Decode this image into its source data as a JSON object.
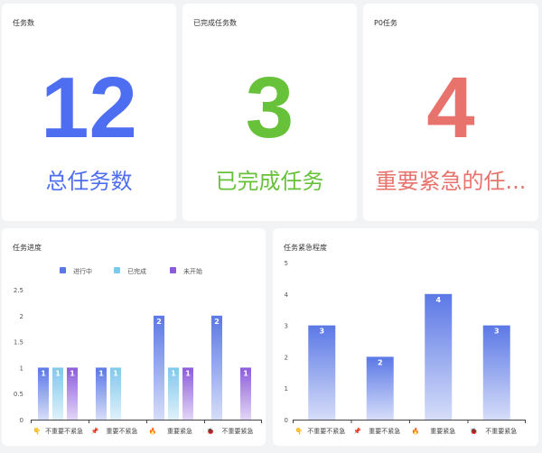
{
  "stats": [
    {
      "title": "任务数",
      "value": "12",
      "label": "总任务数",
      "color": "#4e6ef2"
    },
    {
      "title": "已完成任务数",
      "value": "3",
      "label": "已完成任务",
      "color": "#67c23a"
    },
    {
      "title": "P0任务",
      "value": "4",
      "label": "重要紧急的任...",
      "color": "#e8736c"
    }
  ],
  "progress_chart": {
    "title": "任务进度"
  },
  "urgency_chart": {
    "title": "任务紧急程度"
  },
  "chart_data": [
    {
      "type": "bar",
      "title": "任务进度",
      "categories": [
        "不重要不紧急",
        "重要不紧急",
        "重要紧急",
        "不重要紧急"
      ],
      "category_icons": [
        "👇",
        "📌",
        "🔥",
        "🐞"
      ],
      "series": [
        {
          "name": "进行中",
          "values": [
            1,
            1,
            2,
            2
          ],
          "color": "#5b78e6"
        },
        {
          "name": "已完成",
          "values": [
            1,
            1,
            1,
            0
          ],
          "color": "#7ec8ee"
        },
        {
          "name": "未开始",
          "values": [
            1,
            0,
            1,
            1
          ],
          "color": "#8c5bdc"
        }
      ],
      "ylim": [
        0,
        2.5
      ],
      "yticks": [
        "0",
        "0.5",
        "1",
        "1.5",
        "2",
        "2.5"
      ],
      "legend": "top"
    },
    {
      "type": "bar",
      "title": "任务紧急程度",
      "categories": [
        "不重要不紧急",
        "重要不紧急",
        "重要紧急",
        "不重要紧急"
      ],
      "category_icons": [
        "👇",
        "📌",
        "🔥",
        "🐞"
      ],
      "values": [
        3,
        2,
        4,
        3
      ],
      "color": "#5b78e6",
      "ylim": [
        0,
        5
      ],
      "yticks": [
        "0",
        "1",
        "2",
        "3",
        "4",
        "5"
      ]
    }
  ]
}
